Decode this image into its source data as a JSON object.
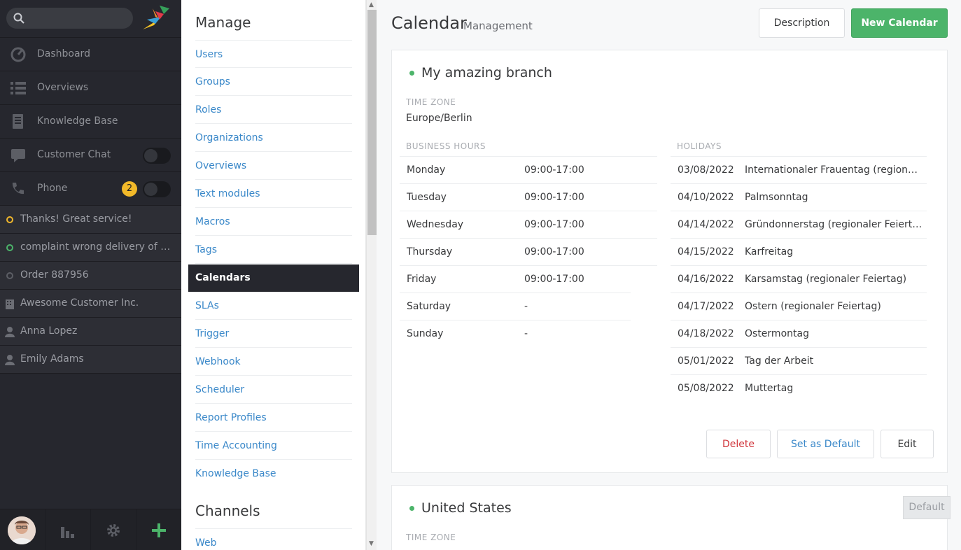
{
  "nav": {
    "items": [
      {
        "label": "Dashboard",
        "icon": "dashboard-icon"
      },
      {
        "label": "Overviews",
        "icon": "overviews-icon"
      },
      {
        "label": "Knowledge Base",
        "icon": "knowledge-base-icon"
      },
      {
        "label": "Customer Chat",
        "icon": "chat-icon"
      },
      {
        "label": "Phone",
        "icon": "phone-icon"
      }
    ],
    "phone_badge": "2",
    "tasks": [
      {
        "label": "Thanks! Great service!",
        "type": "ticket-open"
      },
      {
        "label": "complaint wrong delivery of order",
        "type": "ticket-new"
      },
      {
        "label": "Order 887956",
        "type": "ticket-closed"
      },
      {
        "label": "Awesome Customer Inc.",
        "type": "organization"
      },
      {
        "label": "Anna Lopez",
        "type": "user"
      },
      {
        "label": "Emily Adams",
        "type": "user"
      }
    ]
  },
  "menu": {
    "manage_heading": "Manage",
    "items": [
      "Users",
      "Groups",
      "Roles",
      "Organizations",
      "Overviews",
      "Text modules",
      "Macros",
      "Tags",
      "Calendars",
      "SLAs",
      "Trigger",
      "Webhook",
      "Scheduler",
      "Report Profiles",
      "Time Accounting",
      "Knowledge Base"
    ],
    "active": "Calendars",
    "channels_heading": "Channels",
    "channel_items": [
      "Web"
    ]
  },
  "page": {
    "title": "Calendar",
    "subtitle": "Management",
    "description_button": "Description",
    "new_button": "New Calendar"
  },
  "calendars": [
    {
      "name": "My amazing branch",
      "timezone_label": "TIME ZONE",
      "timezone": "Europe/Berlin",
      "business_hours_label": "BUSINESS HOURS",
      "business_hours": [
        {
          "day": "Monday",
          "hours": "09:00-17:00"
        },
        {
          "day": "Tuesday",
          "hours": "09:00-17:00"
        },
        {
          "day": "Wednesday",
          "hours": "09:00-17:00"
        },
        {
          "day": "Thursday",
          "hours": "09:00-17:00"
        },
        {
          "day": "Friday",
          "hours": "09:00-17:00"
        },
        {
          "day": "Saturday",
          "hours": "-"
        },
        {
          "day": "Sunday",
          "hours": "-"
        }
      ],
      "holidays_label": "HOLIDAYS",
      "holidays": [
        {
          "date": "03/08/2022",
          "name": "Internationaler Frauentag (regionaler Feiertag)"
        },
        {
          "date": "04/10/2022",
          "name": "Palmsonntag"
        },
        {
          "date": "04/14/2022",
          "name": "Gründonnerstag (regionaler Feiertag)"
        },
        {
          "date": "04/15/2022",
          "name": "Karfreitag"
        },
        {
          "date": "04/16/2022",
          "name": "Karsamstag (regionaler Feiertag)"
        },
        {
          "date": "04/17/2022",
          "name": "Ostern (regionaler Feiertag)"
        },
        {
          "date": "04/18/2022",
          "name": "Ostermontag"
        },
        {
          "date": "05/01/2022",
          "name": "Tag der Arbeit"
        },
        {
          "date": "05/08/2022",
          "name": "Muttertag"
        }
      ],
      "delete_button": "Delete",
      "set_default_button": "Set as Default",
      "edit_button": "Edit"
    },
    {
      "name": "United States",
      "timezone_label": "TIME ZONE",
      "default_badge": "Default"
    }
  ],
  "colors": {
    "accent_green": "#4cb46a",
    "link_blue": "#3a88c9",
    "nav_dark": "#26272e",
    "badge_yellow": "#f2b929"
  }
}
